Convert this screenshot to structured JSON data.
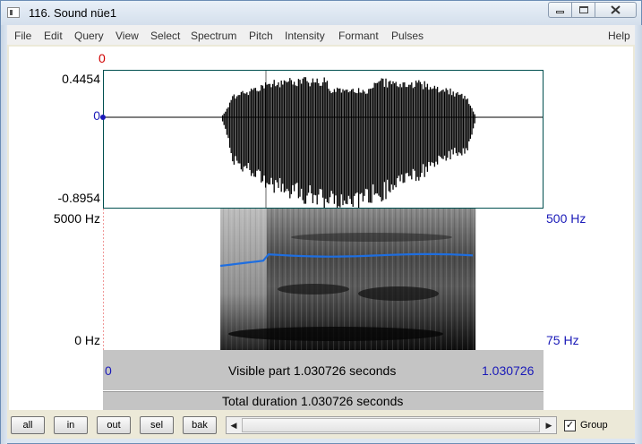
{
  "window": {
    "title": "116. Sound nüe1",
    "minimize_icon": "minimize-icon",
    "maximize_icon": "maximize-icon",
    "close_icon": "close-icon"
  },
  "menu": [
    {
      "label": "File"
    },
    {
      "label": "Edit"
    },
    {
      "label": "Query"
    },
    {
      "label": "View"
    },
    {
      "label": "Select"
    },
    {
      "label": "Spectrum"
    },
    {
      "label": "Pitch"
    },
    {
      "label": "Intensity"
    },
    {
      "label": "Formant"
    },
    {
      "label": "Pulses"
    },
    {
      "label": "Help"
    }
  ],
  "waveform": {
    "cursor_label": "0",
    "y_max": "0.4454",
    "y_zero": "0",
    "y_min": "-0.8954"
  },
  "spectrogram": {
    "freq_max": "5000 Hz",
    "freq_min": "0 Hz",
    "pitch_max": "500 Hz",
    "pitch_min": "75 Hz"
  },
  "info": {
    "start": "0",
    "visible_part": "Visible part 1.030726 seconds",
    "end": "1.030726",
    "total_duration": "Total duration 1.030726 seconds"
  },
  "bottom": {
    "buttons": [
      "all",
      "in",
      "out",
      "sel",
      "bak"
    ],
    "group_label": "Group",
    "group_checked": true,
    "scroll_left_icon": "triangle-left-icon",
    "scroll_right_icon": "triangle-right-icon"
  },
  "colors": {
    "pitch_curve": "#1e6ee0",
    "cursor_red": "#d00000",
    "axis_blue": "#1a1ab8"
  }
}
